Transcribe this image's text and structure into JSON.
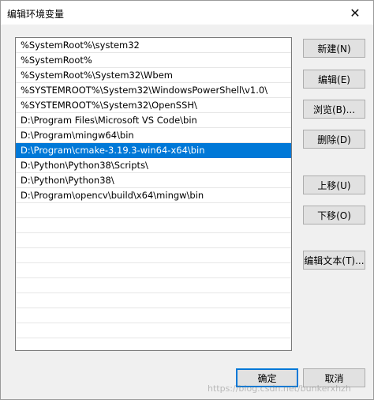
{
  "window": {
    "title": "编辑环境变量",
    "close_glyph": "✕"
  },
  "paths": [
    "%SystemRoot%\\system32",
    "%SystemRoot%",
    "%SystemRoot%\\System32\\Wbem",
    "%SYSTEMROOT%\\System32\\WindowsPowerShell\\v1.0\\",
    "%SYSTEMROOT%\\System32\\OpenSSH\\",
    "D:\\Program Files\\Microsoft VS Code\\bin",
    "D:\\Program\\mingw64\\bin",
    "D:\\Program\\cmake-3.19.3-win64-x64\\bin",
    "D:\\Python\\Python38\\Scripts\\",
    "D:\\Python\\Python38\\",
    "D:\\Program\\opencv\\build\\x64\\mingw\\bin"
  ],
  "selected_index": 7,
  "buttons": {
    "new": "新建(N)",
    "edit": "编辑(E)",
    "browse": "浏览(B)...",
    "delete": "删除(D)",
    "move_up": "上移(U)",
    "move_down": "下移(O)",
    "edit_text": "编辑文本(T)...",
    "ok": "确定",
    "cancel": "取消"
  },
  "watermark": "https://blog.csdn.net/bunkerxhzh",
  "colors": {
    "selection": "#0078d7",
    "button_bg": "#e1e1e1"
  }
}
